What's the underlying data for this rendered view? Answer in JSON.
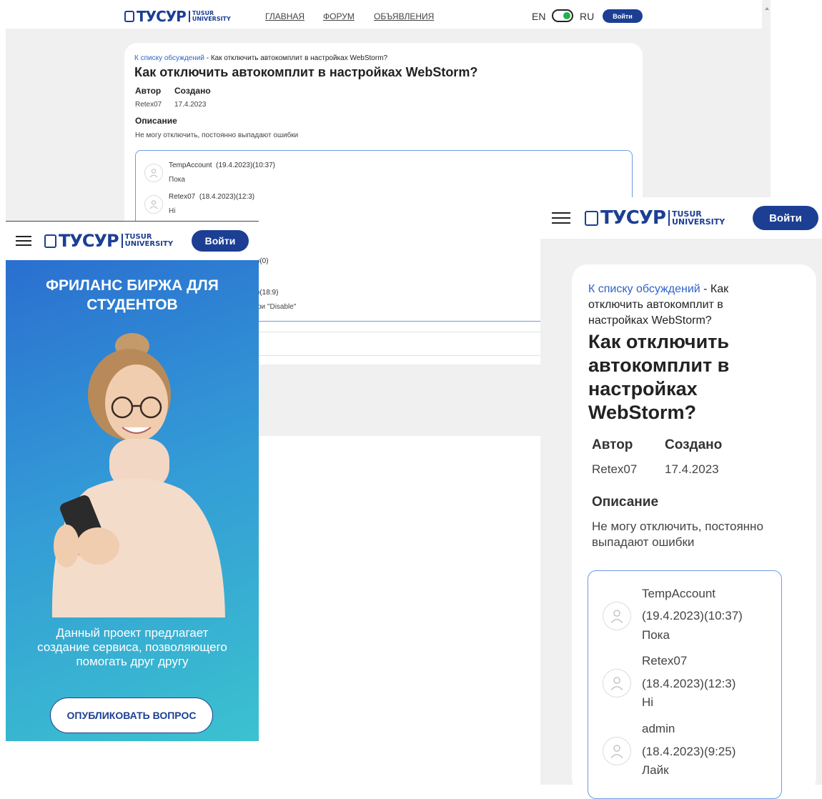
{
  "desktop": {
    "header": {
      "logo_main": "ТУСУР",
      "logo_sub1": "TUSUR",
      "logo_sub2": "UNIVERSITY",
      "nav": [
        "ГЛАВНАЯ",
        "ФОРУМ",
        "ОБЪЯВЛЕНИЯ"
      ],
      "lang_en": "EN",
      "lang_ru": "RU",
      "login": "Войти"
    },
    "card": {
      "breadcrumb_link": "К списку обсуждений",
      "breadcrumb_rest": " - Как отключить автокомплит в настройках WebStorm?",
      "title": "Как отключить автокомплит в настройках WebStorm?",
      "author_label": "Автор",
      "created_label": "Создано",
      "author": "Retex07",
      "created": "17.4.2023",
      "desc_label": "Описание",
      "desc": "Не могу отключить, постоянно выпадают ошибки",
      "comments": [
        {
          "user": "TempAccount",
          "time": "(19.4.2023)(10:37)",
          "text": "Пока"
        },
        {
          "user": "Retex07",
          "time": "(18.4.2023)(12:3)",
          "text": "Hi"
        }
      ],
      "partial_1": ")(0)",
      "partial_2": ")(18:9)",
      "partial_3": "ри \"Disable\""
    }
  },
  "mobile_left": {
    "header": {
      "logo_main": "ТУСУР",
      "logo_sub1": "TUSUR",
      "logo_sub2": "UNIVERSITY",
      "login": "Войти"
    },
    "hero_title": "ФРИЛАНС БИРЖА ДЛЯ СТУДЕНТОВ",
    "hero_text": "Данный проект предлагает создание сервиса, позволяющего помогать друг другу",
    "cta": "ОПУБЛИКОВАТЬ ВОПРОС"
  },
  "mobile_right": {
    "header": {
      "logo_main": "ТУСУР",
      "logo_sub1": "TUSUR",
      "logo_sub2": "UNIVERSITY",
      "login": "Войти"
    },
    "breadcrumb_link": "К списку обсуждений",
    "breadcrumb_rest": " - Как отключить автокомплит в настройках WebStorm?",
    "title": "Как отключить автокомплит в настройках WebStorm?",
    "author_label": "Автор",
    "created_label": "Создано",
    "author": "Retex07",
    "created": "17.4.2023",
    "desc_label": "Описание",
    "desc": "Не могу отключить, постоянно выпадают ошибки",
    "comments": [
      {
        "user": "TempAccount",
        "time": "(19.4.2023)(10:37)",
        "text": "Пока"
      },
      {
        "user": "Retex07",
        "time": "(18.4.2023)(12:3)",
        "text": "Hi"
      },
      {
        "user": "admin",
        "time": "(18.4.2023)(9:25)",
        "text": "Лайк"
      }
    ]
  },
  "colors": {
    "brand": "#1c3f94",
    "link": "#2f64c8",
    "toggle_on": "#22b14c",
    "page_bg": "#f0f0f0"
  }
}
